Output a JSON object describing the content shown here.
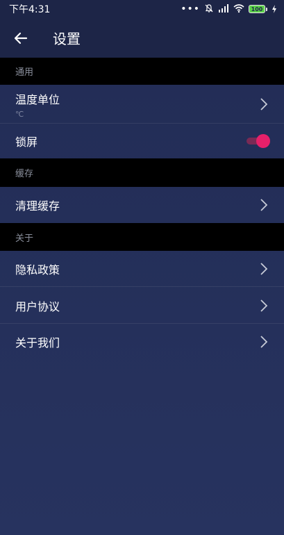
{
  "status_bar": {
    "time": "下午4:31",
    "dots": "•••",
    "battery": "100"
  },
  "header": {
    "title": "设置"
  },
  "sections": {
    "general": {
      "title": "通用",
      "temperature_label": "温度单位",
      "temperature_value": "℃",
      "lock_screen_label": "锁屏",
      "lock_screen_on": true
    },
    "cache": {
      "title": "缓存",
      "clear_cache_label": "清理缓存"
    },
    "about": {
      "title": "关于",
      "privacy_label": "隐私政策",
      "agreement_label": "用户协议",
      "about_us_label": "关于我们"
    }
  },
  "colors": {
    "accent": "#e6206a",
    "background": "#25305a",
    "section_bg": "#000000"
  }
}
